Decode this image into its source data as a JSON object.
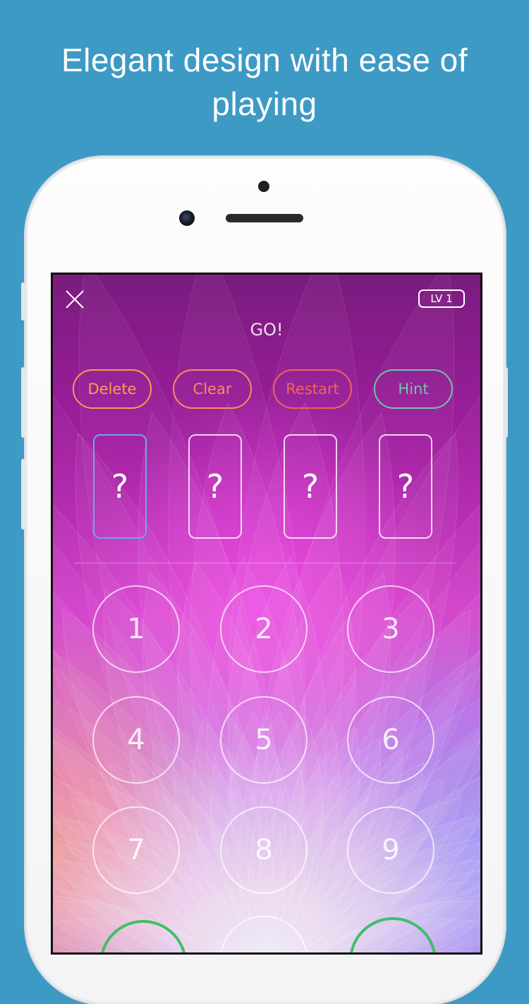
{
  "headline": {
    "line1": "Elegant design with ease of",
    "line2": "playing"
  },
  "game": {
    "close_icon": "close-icon",
    "level": "LV 1",
    "status": "GO!",
    "actions": [
      {
        "label": "Delete",
        "color": "#ff9a4a"
      },
      {
        "label": "Clear",
        "color": "#ff8a5a"
      },
      {
        "label": "Restart",
        "color": "#f0645a"
      },
      {
        "label": "Hint",
        "color": "#6fc4a8"
      }
    ],
    "slots": [
      "?",
      "?",
      "?",
      "?"
    ],
    "active_slot": 0,
    "keypad": [
      "1",
      "2",
      "3",
      "4",
      "5",
      "6",
      "7",
      "8",
      "9"
    ]
  },
  "colors": {
    "background": "#3d9ac4",
    "active_slot_border": "#6aa7f2",
    "bottom_ring": "#3fbf6a"
  }
}
